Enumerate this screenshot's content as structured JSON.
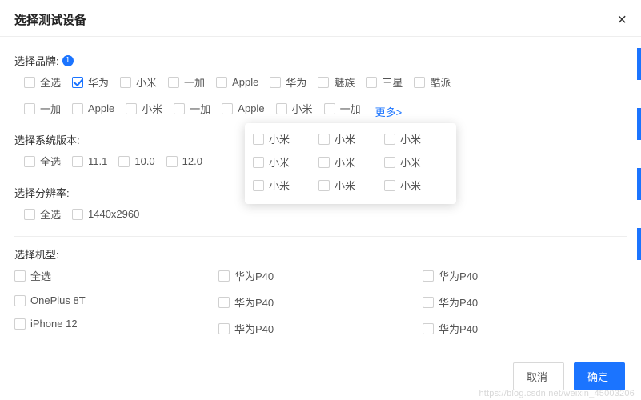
{
  "header": {
    "title": "选择测试设备",
    "close_label": "×"
  },
  "brand": {
    "label": "选择品牌:",
    "badge": "1",
    "row1": [
      {
        "label": "全选",
        "checked": false
      },
      {
        "label": "华为",
        "checked": true
      },
      {
        "label": "小米",
        "checked": false
      },
      {
        "label": "一加",
        "checked": false
      },
      {
        "label": "Apple",
        "checked": false
      },
      {
        "label": "华为",
        "checked": false
      },
      {
        "label": "魅族",
        "checked": false
      },
      {
        "label": "三星",
        "checked": false
      },
      {
        "label": "酷派",
        "checked": false
      }
    ],
    "row2": [
      {
        "label": "一加",
        "checked": false
      },
      {
        "label": "Apple",
        "checked": false
      },
      {
        "label": "小米",
        "checked": false
      },
      {
        "label": "一加",
        "checked": false
      },
      {
        "label": "Apple",
        "checked": false
      },
      {
        "label": "小米",
        "checked": false
      },
      {
        "label": "一加",
        "checked": false
      }
    ],
    "more": "更多>"
  },
  "os": {
    "label": "选择系统版本:",
    "row": [
      {
        "label": "全选",
        "checked": false
      },
      {
        "label": "11.1",
        "checked": false
      },
      {
        "label": "10.0",
        "checked": false
      },
      {
        "label": "12.0",
        "checked": false
      }
    ]
  },
  "res": {
    "label": "选择分辨率:",
    "row": [
      {
        "label": "全选",
        "checked": false
      },
      {
        "label": "1440x2960",
        "checked": false
      }
    ]
  },
  "model": {
    "label": "选择机型:",
    "col1": [
      {
        "label": "全选",
        "checked": false
      },
      {
        "label": "OnePlus 8T",
        "checked": false
      },
      {
        "label": "iPhone 12",
        "checked": false
      }
    ],
    "col2": [
      {
        "label": "华为P40",
        "checked": false
      },
      {
        "label": "华为P40",
        "checked": false
      },
      {
        "label": "华为P40",
        "checked": false
      }
    ],
    "col3": [
      {
        "label": "华为P40",
        "checked": false
      },
      {
        "label": "华为P40",
        "checked": false
      },
      {
        "label": "华为P40",
        "checked": false
      }
    ]
  },
  "popover": {
    "rows": [
      [
        {
          "label": "小米"
        },
        {
          "label": "小米"
        },
        {
          "label": "小米"
        }
      ],
      [
        {
          "label": "小米"
        },
        {
          "label": "小米"
        },
        {
          "label": "小米"
        }
      ],
      [
        {
          "label": "小米"
        },
        {
          "label": "小米"
        },
        {
          "label": "小米"
        }
      ]
    ]
  },
  "footer": {
    "cancel": "取消",
    "confirm": "确定"
  },
  "watermark": "https://blog.csdn.net/weixin_45003206"
}
